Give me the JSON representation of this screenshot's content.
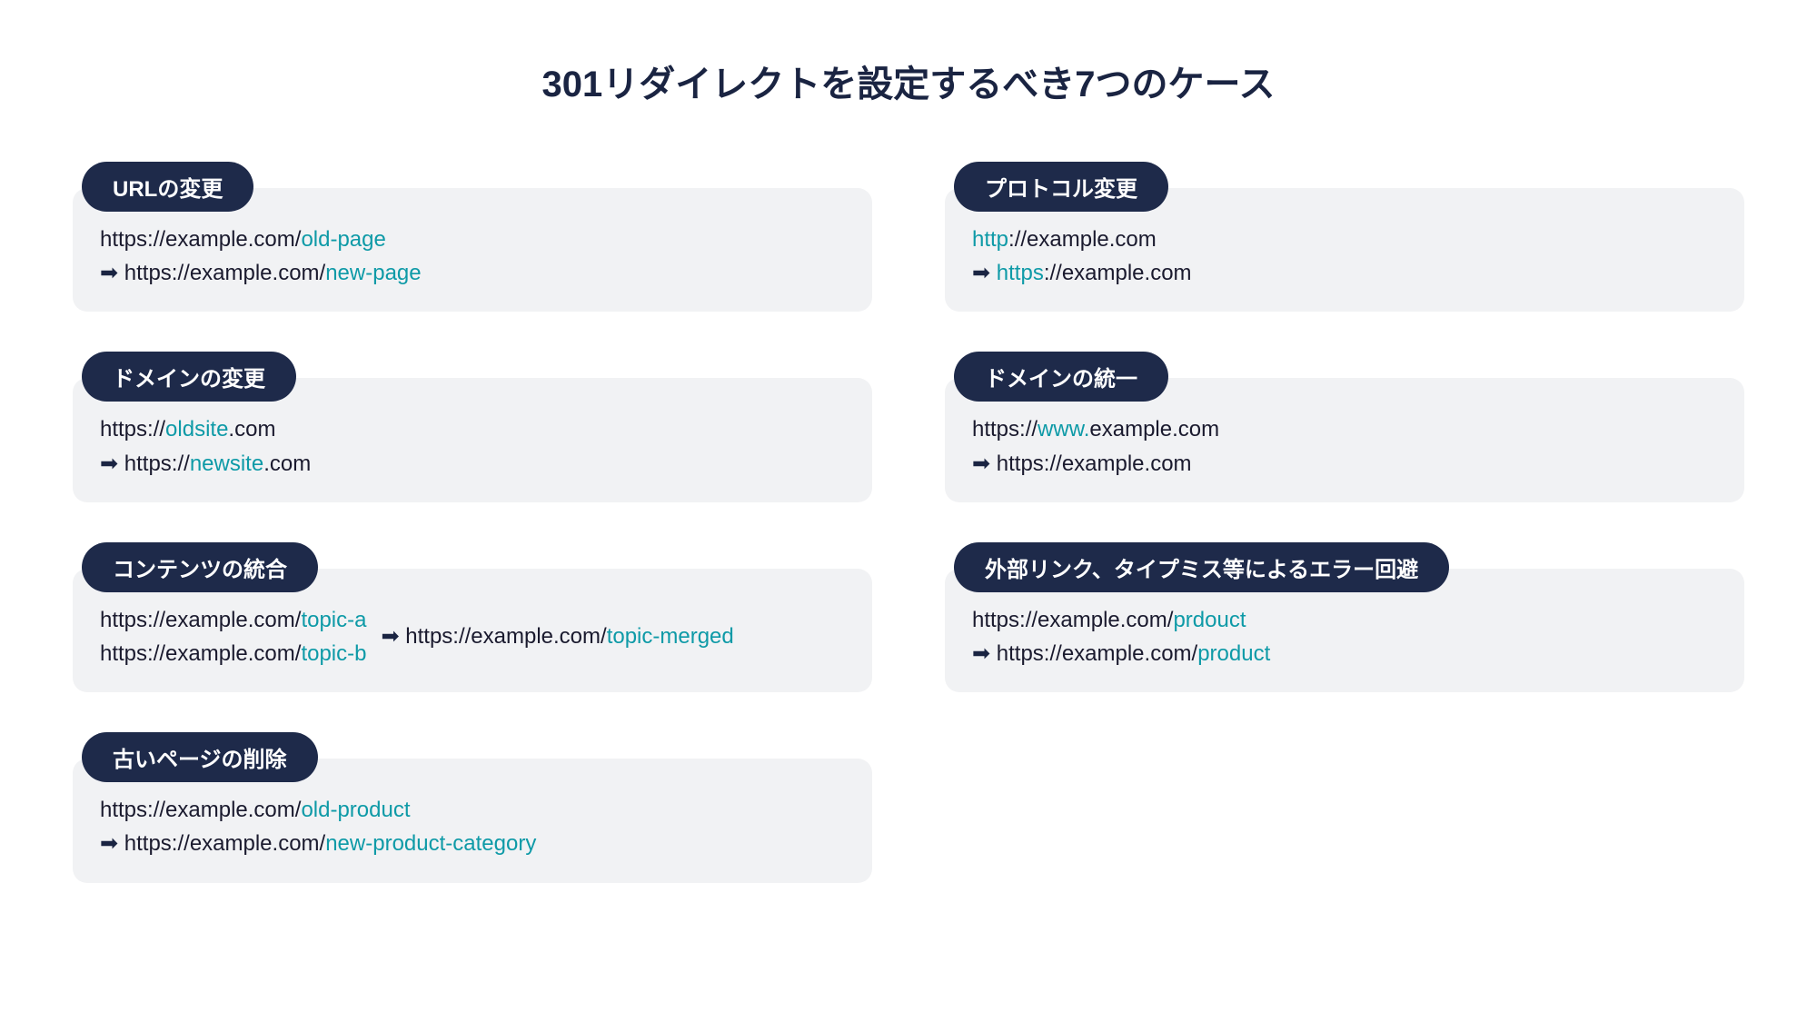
{
  "title": "301リダイレクトを設定するべき7つのケース",
  "arrow": "➡",
  "left": [
    {
      "pill": "URLの変更",
      "line1": {
        "pre": "https://example.com/",
        "hl": "old-page",
        "post": ""
      },
      "line2": {
        "arrow": true,
        "pre": " https://example.com/",
        "hl": "new-page",
        "post": ""
      }
    },
    {
      "pill": "ドメインの変更",
      "line1": {
        "pre": "https://",
        "hl": "oldsite",
        "post": ".com"
      },
      "line2": {
        "arrow": true,
        "pre": " https://",
        "hl": "newsite",
        "post": ".com"
      }
    },
    {
      "pill": "コンテンツの統合",
      "inline": {
        "leftLines": [
          {
            "pre": "https://example.com/",
            "hl": "topic-a",
            "post": ""
          },
          {
            "pre": "https://example.com/",
            "hl": "topic-b",
            "post": ""
          }
        ],
        "right": {
          "arrow": true,
          "pre": " https://example.com/",
          "hl": "topic-merged",
          "post": ""
        }
      }
    },
    {
      "pill": "古いページの削除",
      "line1": {
        "pre": "https://example.com/",
        "hl": "old-product",
        "post": ""
      },
      "line2": {
        "arrow": true,
        "pre": " https://example.com/",
        "hl": "new-product-category",
        "post": ""
      }
    }
  ],
  "right": [
    {
      "pill": "プロトコル変更",
      "line1": {
        "pre": "",
        "hl": "http",
        "post": "://example.com"
      },
      "line2": {
        "arrow": true,
        "pre": " ",
        "hl": "https",
        "post": "://example.com"
      }
    },
    {
      "pill": "ドメインの統一",
      "line1": {
        "pre": "https://",
        "hl": "www.",
        "post": "example.com"
      },
      "line2": {
        "arrow": true,
        "pre": " https://example.com",
        "hl": "",
        "post": ""
      }
    },
    {
      "pill": "外部リンク、タイプミス等によるエラー回避",
      "line1": {
        "pre": "https://example.com/",
        "hl": "prdouct",
        "post": ""
      },
      "line2": {
        "arrow": true,
        "pre": " https://example.com/",
        "hl": "product",
        "post": ""
      }
    }
  ]
}
